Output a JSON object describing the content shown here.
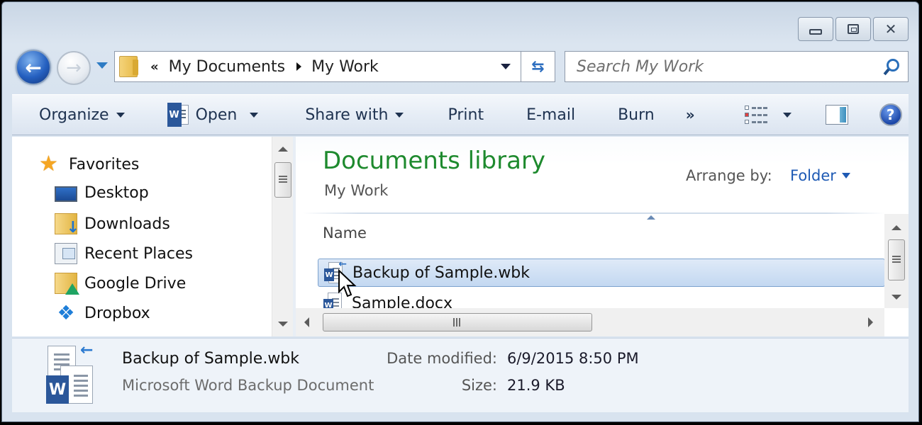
{
  "window": {
    "caption_buttons": {
      "minimize": "minimize",
      "maximize": "maximize",
      "close": "close"
    }
  },
  "navigation": {
    "back_icon": "back-arrow-icon",
    "forward_icon": "forward-arrow-icon",
    "history_icon": "chevron-down-icon"
  },
  "address_bar": {
    "overflow_label": "«",
    "breadcrumbs": [
      "My Documents",
      "My Work"
    ],
    "refresh_icon": "refresh-icon"
  },
  "search": {
    "placeholder": "Search My Work",
    "value": ""
  },
  "command_bar": {
    "items": [
      {
        "label": "Organize",
        "has_dropdown": true
      },
      {
        "label": "Open",
        "has_dropdown": true,
        "icon": "word-icon"
      },
      {
        "label": "Share with",
        "has_dropdown": true
      },
      {
        "label": "Print"
      },
      {
        "label": "E-mail"
      },
      {
        "label": "Burn"
      }
    ],
    "more_label": "»",
    "views_icon": "views-icon",
    "preview_pane_icon": "preview-pane-icon",
    "help_label": "?"
  },
  "nav_pane": {
    "favorites": {
      "label": "Favorites",
      "icon": "star-icon"
    },
    "items": [
      {
        "label": "Desktop",
        "icon": "desktop-icon"
      },
      {
        "label": "Downloads",
        "icon": "downloads-icon"
      },
      {
        "label": "Recent Places",
        "icon": "recent-places-icon"
      },
      {
        "label": "Google Drive",
        "icon": "google-drive-icon"
      },
      {
        "label": "Dropbox",
        "icon": "dropbox-icon"
      }
    ]
  },
  "content": {
    "library_title": "Documents library",
    "library_subtitle": "My Work",
    "arrange_label": "Arrange by:",
    "arrange_value": "Folder",
    "columns": [
      "Name"
    ],
    "files": [
      {
        "name": "Backup of Sample.wbk",
        "selected": true,
        "icon": "word-backup-icon"
      },
      {
        "name": "Sample.docx",
        "selected": false,
        "icon": "word-doc-icon"
      }
    ]
  },
  "details": {
    "file_name": "Backup of Sample.wbk",
    "file_type": "Microsoft Word Backup Document",
    "date_modified_label": "Date modified:",
    "date_modified_value": "6/9/2015 8:50 PM",
    "size_label": "Size:",
    "size_value": "21.9 KB",
    "badge_letter": "W"
  },
  "colors": {
    "library_title": "#1e8a2e",
    "link_blue": "#1e5ab4",
    "selection_bg": "#c3d8f1",
    "word_blue": "#2b579a"
  }
}
